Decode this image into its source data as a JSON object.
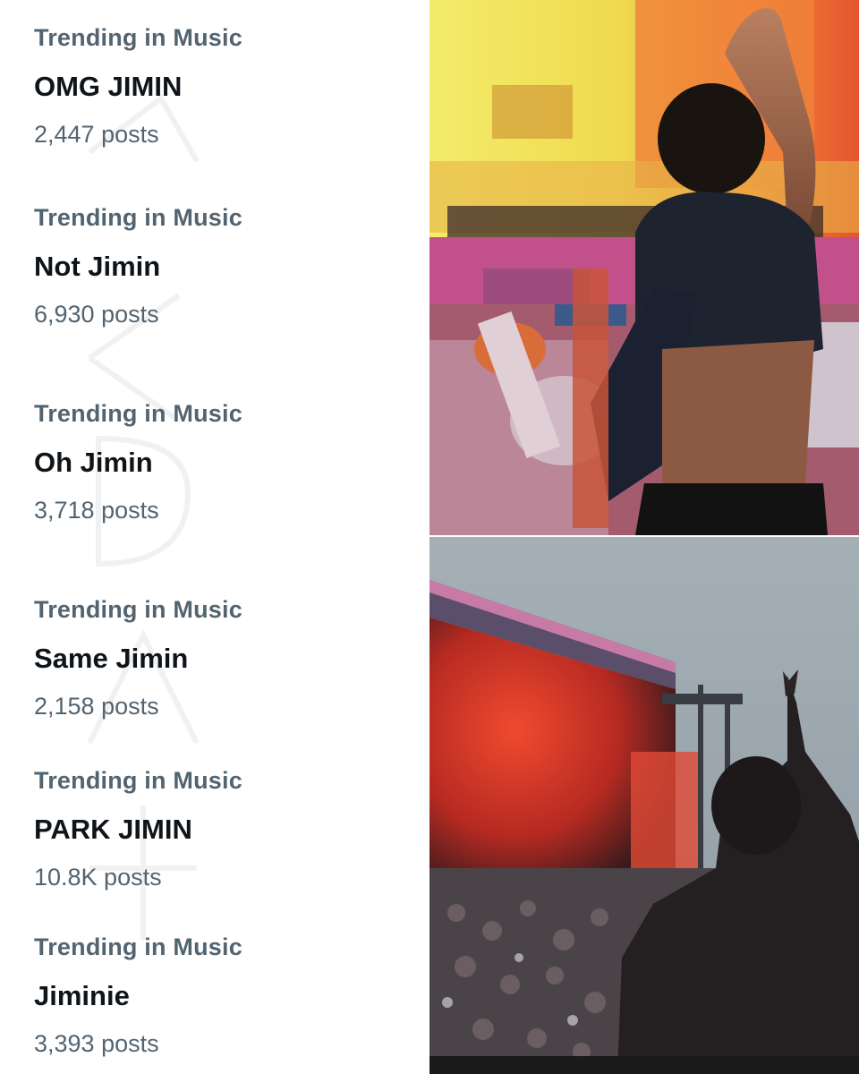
{
  "trends": [
    {
      "category": "Trending in Music",
      "name": "OMG JIMIN",
      "posts": "2,447 posts"
    },
    {
      "category": "Trending in Music",
      "name": "Not Jimin",
      "posts": "6,930 posts"
    },
    {
      "category": "Trending in Music",
      "name": "Oh Jimin",
      "posts": "3,718 posts"
    },
    {
      "category": "Trending in Music",
      "name": "Same Jimin",
      "posts": "2,158 posts"
    },
    {
      "category": "Trending in Music",
      "name": "PARK JIMIN",
      "posts": "10.8K posts"
    },
    {
      "category": "Trending in Music",
      "name": "Jiminie",
      "posts": "3,393 posts"
    }
  ],
  "colors": {
    "category_text": "#536471",
    "name_text": "#0f1419",
    "count_text": "#536471"
  },
  "photos": {
    "top": "concert-photo-stage-crowd",
    "bottom": "festival-photo-outdoor-stage"
  }
}
